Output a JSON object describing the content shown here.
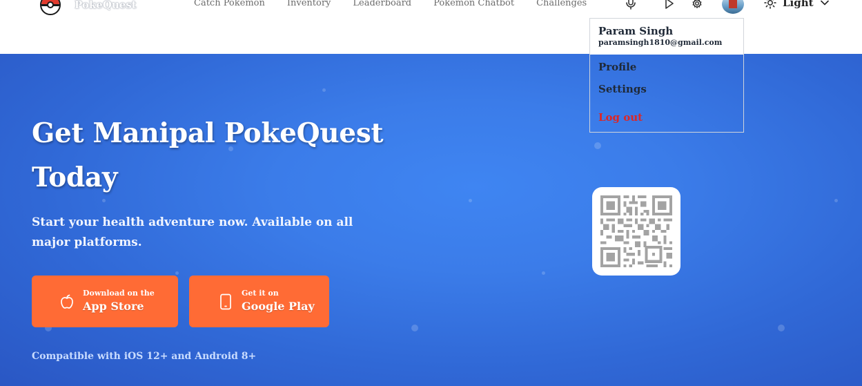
{
  "brand": {
    "name": "PokeQuest"
  },
  "nav": {
    "links": [
      "Catch Pokemon",
      "Inventory",
      "Leaderboard",
      "Pokémon Chatbot",
      "Challenges"
    ],
    "theme_label": "Light"
  },
  "dropdown": {
    "user_name": "Param Singh",
    "user_email": "paramsingh1810@gmail.com",
    "profile": "Profile",
    "settings": "Settings",
    "logout": "Log out"
  },
  "hero": {
    "title": "Get Manipal PokeQuest Today",
    "subtitle": "Start your health adventure now. Available on all major platforms.",
    "app_store": {
      "small": "Download on the",
      "big": "App Store"
    },
    "google_play": {
      "small": "Get it on",
      "big": "Google Play"
    },
    "compat": "Compatible with iOS 12+ and Android 8+"
  },
  "icons": [
    "pokeball-icon",
    "mic-icon",
    "play-icon",
    "gear-icon",
    "sun-icon",
    "chevron-down-icon",
    "apple-icon",
    "phone-icon",
    "qr-code-icon"
  ],
  "colors": {
    "hero_blue": "#3b7ce9",
    "button_orange": "#ff6b35",
    "logout_red": "#dc2626",
    "nav_text": "#6b6b6b"
  }
}
